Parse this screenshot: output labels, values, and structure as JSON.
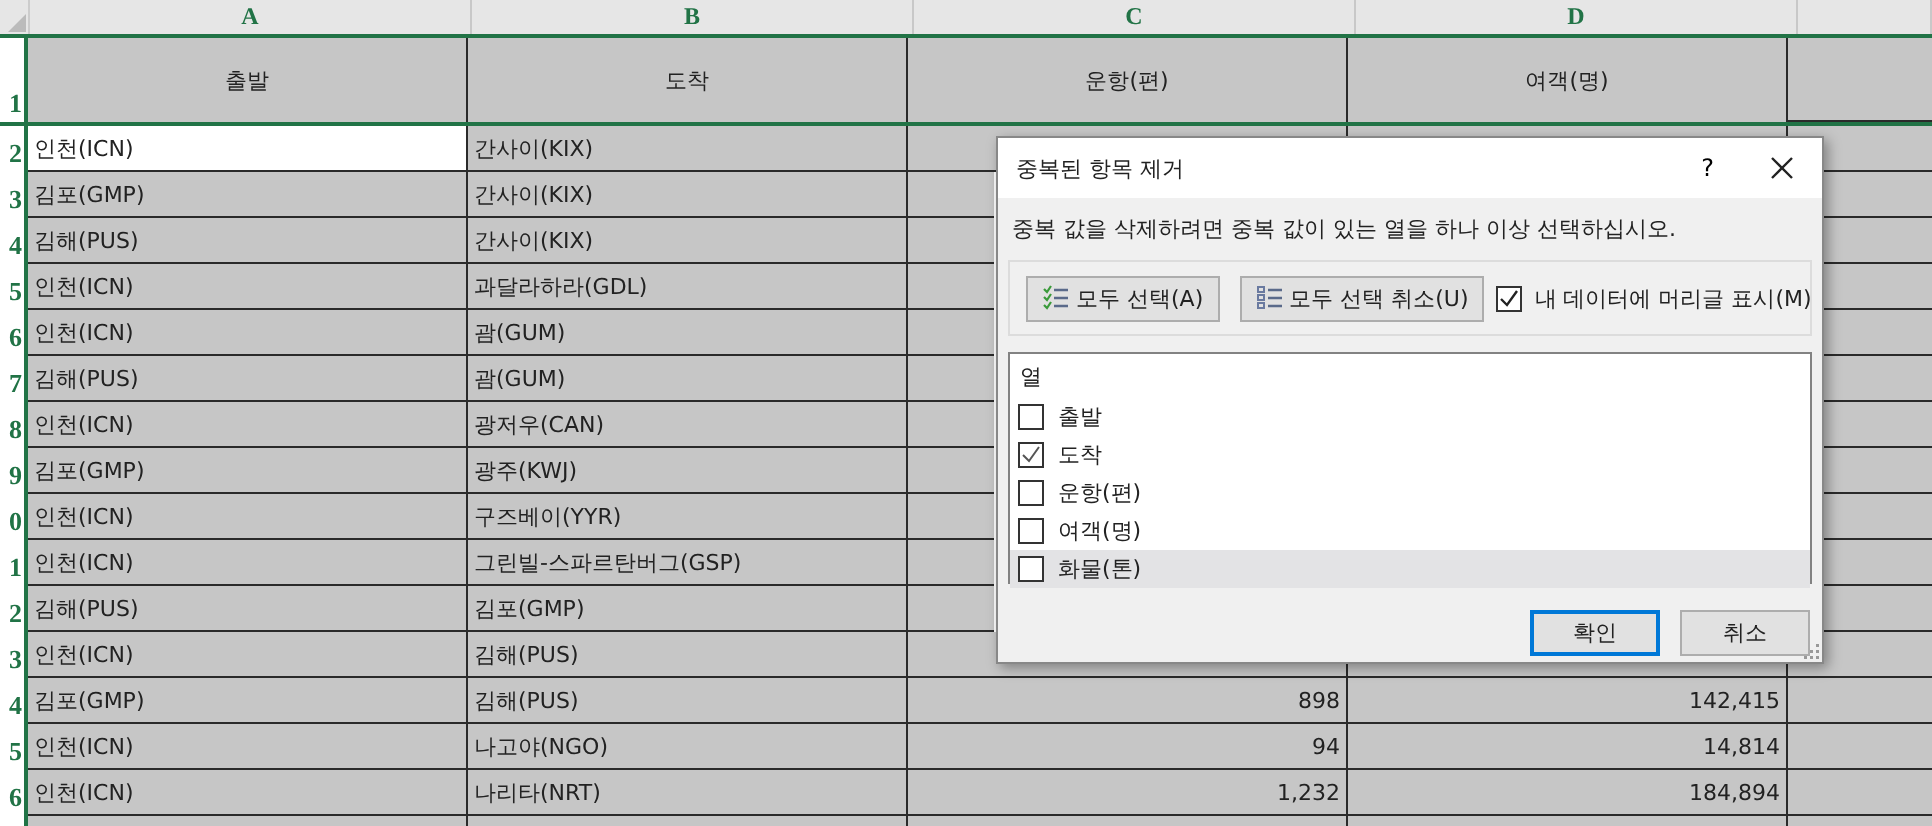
{
  "sheet": {
    "columns": [
      {
        "letter": "A",
        "selected": true
      },
      {
        "letter": "B",
        "selected": true
      },
      {
        "letter": "C",
        "selected": true
      },
      {
        "letter": "D",
        "selected": true
      }
    ],
    "header_row": {
      "number": "1",
      "cells": [
        "출발",
        "도착",
        "운항(편)",
        "여객(명)"
      ]
    },
    "rows": [
      {
        "number": "2",
        "cells": [
          "인천(ICN)",
          "간사이(KIX)"
        ],
        "active": true
      },
      {
        "number": "3",
        "cells": [
          "김포(GMP)",
          "간사이(KIX)"
        ],
        "active": false
      },
      {
        "number": "4",
        "cells": [
          "김해(PUS)",
          "간사이(KIX)"
        ],
        "active": false
      },
      {
        "number": "5",
        "cells": [
          "인천(ICN)",
          "과달라하라(GDL)"
        ],
        "active": false
      },
      {
        "number": "6",
        "cells": [
          "인천(ICN)",
          "괌(GUM)"
        ],
        "active": false
      },
      {
        "number": "7",
        "cells": [
          "김해(PUS)",
          "괌(GUM)"
        ],
        "active": false
      },
      {
        "number": "8",
        "cells": [
          "인천(ICN)",
          "광저우(CAN)"
        ],
        "active": false
      },
      {
        "number": "9",
        "cells": [
          "김포(GMP)",
          "광주(KWJ)"
        ],
        "active": false
      },
      {
        "number": "0",
        "cells": [
          "인천(ICN)",
          "구즈베이(YYR)"
        ],
        "active": false
      },
      {
        "number": "1",
        "cells": [
          "인천(ICN)",
          "그린빌-스파르탄버그(GSP)"
        ],
        "active": false
      },
      {
        "number": "2",
        "cells": [
          "김해(PUS)",
          "김포(GMP)"
        ],
        "active": false
      },
      {
        "number": "3",
        "cells": [
          "인천(ICN)",
          "김해(PUS)"
        ],
        "active": false
      },
      {
        "number": "4",
        "cells": [
          "김포(GMP)",
          "김해(PUS)",
          "898",
          "142,415"
        ],
        "active": false
      },
      {
        "number": "5",
        "cells": [
          "인천(ICN)",
          "나고야(NGO)",
          "94",
          "14,814"
        ],
        "active": false
      },
      {
        "number": "6",
        "cells": [
          "인천(ICN)",
          "나리타(NRT)",
          "1,232",
          "184,894"
        ],
        "active": false
      }
    ]
  },
  "dialog": {
    "title": "중복된 항목 제거",
    "help": "?",
    "instruction": "중복 값을 삭제하려면 중복 값이 있는 열을 하나 이상 선택하십시오.",
    "select_all": "모두 선택(A)",
    "unselect_all": "모두 선택 취소(U)",
    "headers_checkbox": {
      "label": "내 데이터에 머리글 표시(M)",
      "checked": true
    },
    "columns_header": "열",
    "columns": [
      {
        "label": "출발",
        "checked": false,
        "selected": false
      },
      {
        "label": "도착",
        "checked": true,
        "selected": false
      },
      {
        "label": "운항(편)",
        "checked": false,
        "selected": false
      },
      {
        "label": "여객(명)",
        "checked": false,
        "selected": false
      },
      {
        "label": "화물(톤)",
        "checked": false,
        "selected": true
      }
    ],
    "buttons": [
      {
        "label": "확인",
        "kind": "default"
      },
      {
        "label": "취소",
        "kind": "normal"
      }
    ]
  }
}
